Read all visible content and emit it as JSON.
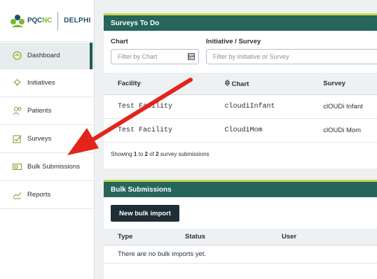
{
  "logo": {
    "part1": "PQC",
    "part2": "NC",
    "part3": "DELPHI"
  },
  "nav": [
    {
      "label": "Dashboard",
      "icon": "dashboard-icon"
    },
    {
      "label": "Initiatives",
      "icon": "lightbulb-icon"
    },
    {
      "label": "Patients",
      "icon": "users-icon"
    },
    {
      "label": "Surveys",
      "icon": "checkbox-icon"
    },
    {
      "label": "Bulk Submissions",
      "icon": "bulk-icon"
    },
    {
      "label": "Reports",
      "icon": "chart-line-icon"
    }
  ],
  "surveys": {
    "title": "Surveys To Do",
    "chart_label": "Chart",
    "chart_placeholder": "Filter by Chart",
    "survey_label": "Initiative / Survey",
    "survey_placeholder": "Filter by Initiative or Survey",
    "columns": {
      "facility": "Facility",
      "chart": "Chart",
      "survey": "Survey"
    },
    "rows": [
      {
        "facility": "Test Facility",
        "chart": "cloudiInfant",
        "survey": "clOUDi Infant"
      },
      {
        "facility": "Test Facility",
        "chart": "CloudiMom",
        "survey": "clOUDi Mom"
      }
    ],
    "showing_prefix": "Showing ",
    "showing_from": "1",
    "showing_to_word": " to ",
    "showing_to": "2",
    "showing_of_word": " of ",
    "showing_total": "2",
    "showing_suffix": " survey submissions"
  },
  "bulk": {
    "title": "Bulk Submissions",
    "button": "New bulk import",
    "columns": {
      "type": "Type",
      "status": "Status",
      "user": "User"
    },
    "empty": "There are no bulk imports yet."
  },
  "colors": {
    "accent": "#25655a",
    "arrow": "#e3241b",
    "lime": "#c8d84a"
  }
}
